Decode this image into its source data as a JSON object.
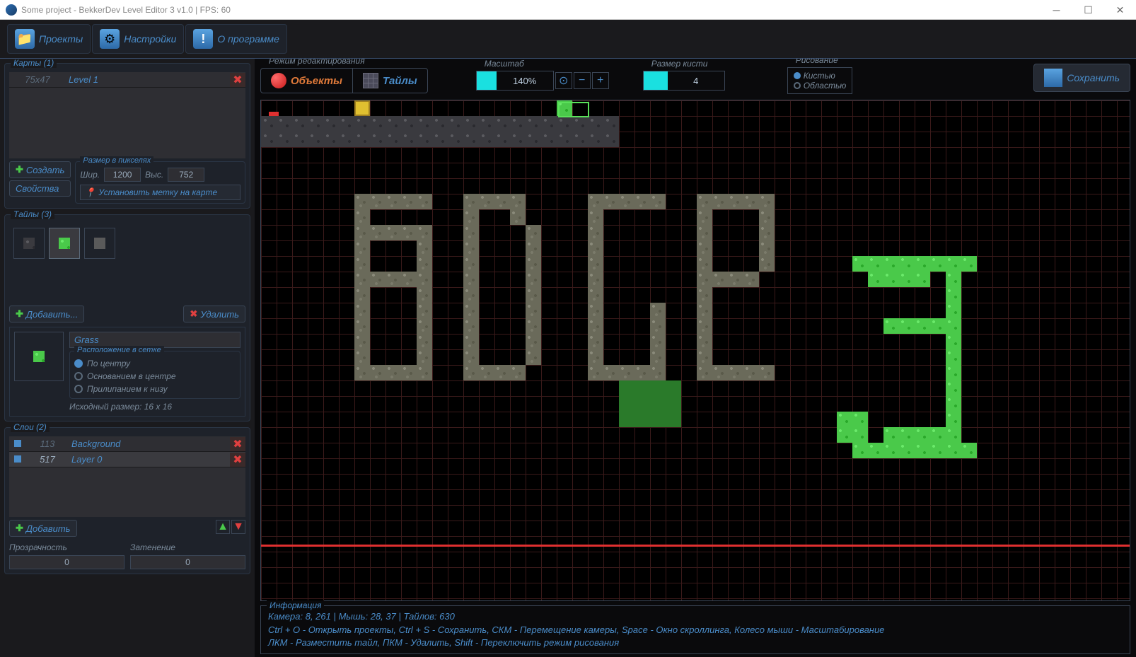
{
  "window": {
    "title": "Some project - BekkerDev Level Editor 3 v1.0 | FPS: 60"
  },
  "toolbar": {
    "projects": "Проекты",
    "settings": "Настройки",
    "about": "О программе"
  },
  "maps": {
    "title": "Карты (1)",
    "items": [
      {
        "size": "75x47",
        "name": "Level 1"
      }
    ],
    "create": "Создать",
    "properties": "Свойства",
    "px_title": "Размер в пикселях",
    "w_label": "Шир.",
    "w_val": "1200",
    "h_label": "Выс.",
    "h_val": "752",
    "mark": "Установить метку на карте"
  },
  "tiles": {
    "title": "Тайлы (3)",
    "add": "Добавить...",
    "del": "Удалить",
    "name": "Grass",
    "placement_title": "Расположение в сетке",
    "opt_center": "По центру",
    "opt_base": "Основанием в центре",
    "opt_bottom": "Прилипанием к низу",
    "src": "Исходный размер: 16 х 16"
  },
  "layers": {
    "title": "Слои (2)",
    "items": [
      {
        "num": "113",
        "name": "Background",
        "active": false
      },
      {
        "num": "517",
        "name": "Layer 0",
        "active": true
      }
    ],
    "add": "Добавить",
    "opacity_label": "Прозрачность",
    "opacity_val": "0",
    "shade_label": "Затенение",
    "shade_val": "0"
  },
  "mode": {
    "title": "Режим редактирования",
    "objects": "Объекты",
    "tiles": "Тайлы"
  },
  "scale": {
    "title": "Масштаб",
    "val": "140%"
  },
  "brush": {
    "title": "Размер кисти",
    "val": "4"
  },
  "draw": {
    "title": "Рисование",
    "brush": "Кистью",
    "area": "Областью"
  },
  "save": "Сохранить",
  "info": {
    "title": "Информация",
    "line1": "Камера: 8, 261 | Мышь: 28, 37 | Тайлов: 630",
    "line2": "Ctrl + O - Открыть проекты, Ctrl + S - Сохранить, СКМ - Перемещение камеры, Space - Окно скроллинга, Колесо мыши - Масштабирование",
    "line3": "ЛКМ - Разместить тайл, ПКМ - Удалить, Shift - Переключить режим рисования"
  }
}
